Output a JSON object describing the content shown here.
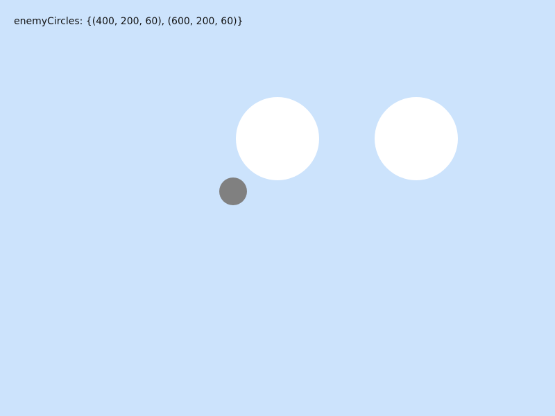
{
  "debug": {
    "enemy_circles_text": "enemyCircles: {(400, 200, 60), (600, 200, 60)}"
  },
  "colors": {
    "background": "#cce3fc",
    "enemy": "#ffffff",
    "player": "#808080",
    "text": "#111111"
  }
}
